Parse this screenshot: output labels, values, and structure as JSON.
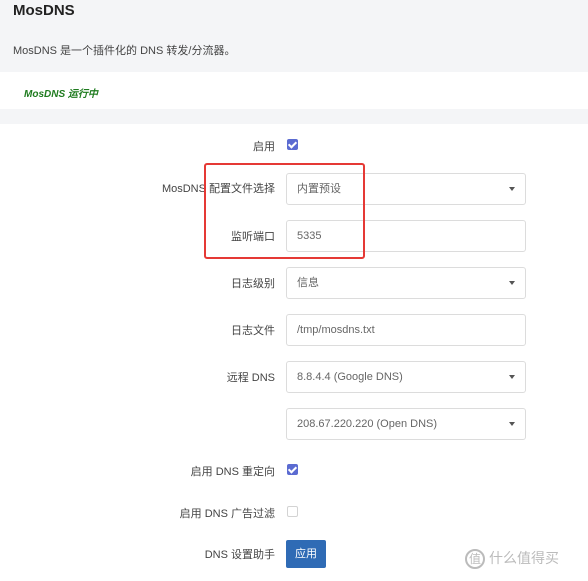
{
  "header": {
    "title": "MosDNS",
    "description": "MosDNS 是一个插件化的 DNS 转发/分流器。"
  },
  "status": {
    "text": "MosDNS 运行中"
  },
  "form": {
    "enable_label": "启用",
    "config_label": "MosDNS 配置文件选择",
    "config_value": "内置预设",
    "port_label": "监听端口",
    "port_value": "5335",
    "log_level_label": "日志级别",
    "log_level_value": "信息",
    "log_file_label": "日志文件",
    "log_file_value": "/tmp/mosdns.txt",
    "remote_dns_label": "远程 DNS",
    "remote_dns_1": "8.8.4.4 (Google DNS)",
    "remote_dns_2": "208.67.220.220 (Open DNS)",
    "redirect_label": "启用 DNS 重定向",
    "adblock_label": "启用 DNS 广告过滤",
    "helper_label": "DNS 设置助手",
    "apply_label": "应用"
  },
  "watermark": {
    "icon": "值",
    "text": "什么值得买"
  },
  "colors": {
    "accent": "#5b6bd1",
    "primary_button": "#2f6bb5",
    "status_green": "#1e7b1e",
    "highlight": "#e53935"
  }
}
